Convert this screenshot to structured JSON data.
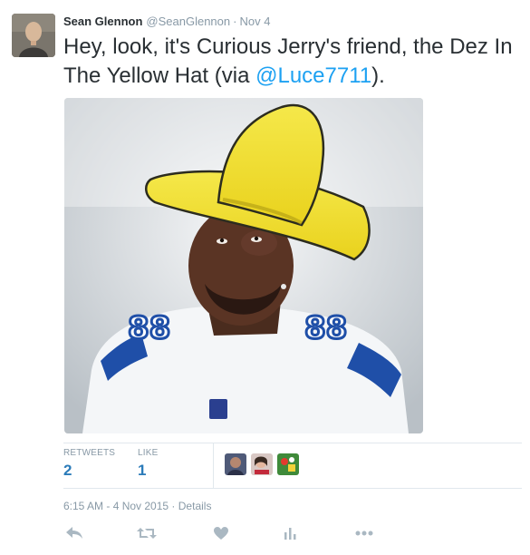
{
  "tweet": {
    "display_name": "Sean Glennon",
    "screen_name": "@SeanGlennon",
    "separator": "·",
    "date": "Nov 4",
    "text_before": "Hey, look, it's Curious Jerry's friend, the Dez In The Yellow Hat (via ",
    "mention": "@Luce7711",
    "text_after": ")."
  },
  "stats": {
    "retweets_label": "RETWEETS",
    "retweets_count": "2",
    "likes_label": "LIKE",
    "likes_count": "1"
  },
  "meta": {
    "time": "6:15 AM - 4 Nov 2015",
    "separator": "·",
    "details": "Details"
  },
  "actions": [
    "reply-icon",
    "retweet-icon",
    "heart-icon",
    "analytics-icon",
    "more-icon"
  ],
  "colors": {
    "link": "#1da1f2",
    "count": "#2b7bb9",
    "muted": "#8899a6",
    "hat": "#f2e22e",
    "jersey_blue": "#1f4fa8"
  }
}
